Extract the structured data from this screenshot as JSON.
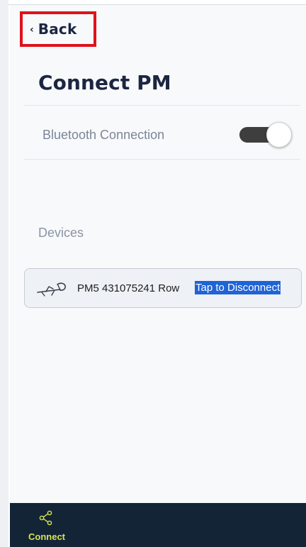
{
  "header": {
    "back_chevron": "‹",
    "back_label": "Back",
    "title": "Connect PM"
  },
  "bluetooth": {
    "label": "Bluetooth Connection",
    "enabled": true
  },
  "devices": {
    "section_label": "Devices",
    "items": [
      {
        "icon": "rower-icon",
        "name": "PM5 431075241 Row",
        "action_label": "Tap to Disconnect"
      }
    ]
  },
  "bottom_nav": {
    "items": [
      {
        "icon": "share-icon",
        "label": "Connect",
        "active": true
      }
    ]
  },
  "colors": {
    "highlight_border": "#e0111a",
    "title_text": "#1c2541",
    "selection_bg": "#1f63d6",
    "nav_bg": "#132437",
    "nav_active": "#d9e54a"
  }
}
